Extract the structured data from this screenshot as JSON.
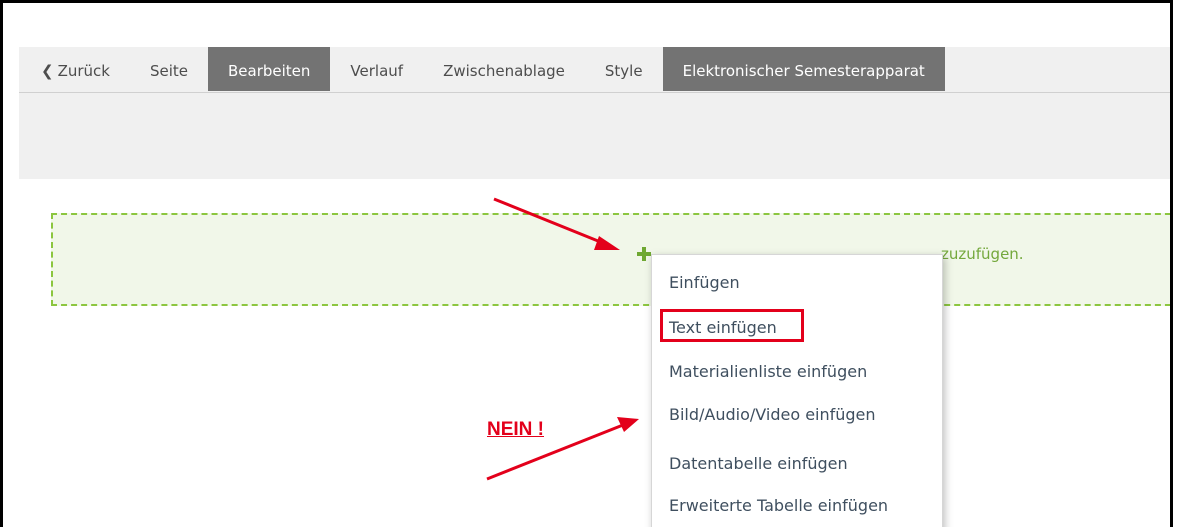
{
  "tabs": [
    {
      "label": "Zurück",
      "icon": "chevron-left-icon"
    },
    {
      "label": "Seite"
    },
    {
      "label": "Bearbeiten"
    },
    {
      "label": "Verlauf"
    },
    {
      "label": "Zwischenablage"
    },
    {
      "label": "Style"
    },
    {
      "label": "Elektronischer Semesterapparat"
    }
  ],
  "dropzone": {
    "visible_text": "zuzufügen.",
    "icon": "plus-icon"
  },
  "context_menu": {
    "items": [
      {
        "label": "Einfügen"
      },
      {
        "label": "Text einfügen"
      },
      {
        "label": "Materialienliste einfügen"
      },
      {
        "label": "Bild/Audio/Video einfügen"
      },
      {
        "label": "Datentabelle einfügen"
      },
      {
        "label": "Erweiterte Tabelle einfügen"
      }
    ]
  },
  "annotation": {
    "nein_label": "NEIN !",
    "color": "#e3001b"
  },
  "colors": {
    "active_tab": "#737373",
    "dropzone_border": "#8cc63f",
    "dropzone_text": "#74a83c"
  }
}
